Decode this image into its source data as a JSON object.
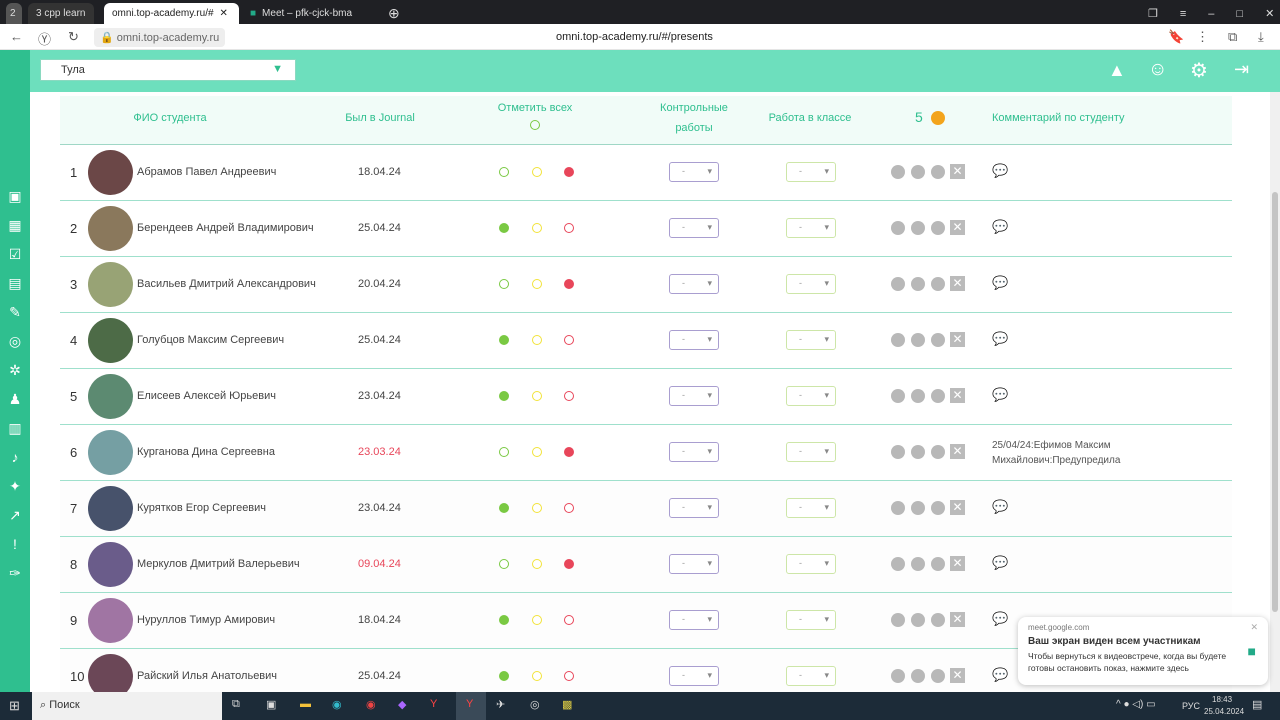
{
  "browser": {
    "tab_group_count": "2",
    "tabs": [
      {
        "label": "3  cpp learn"
      },
      {
        "label": "omni.top-academy.ru/#"
      },
      {
        "label": "Meet – pfk-cjck-bma"
      }
    ],
    "address_short": "omni.top-academy.ru",
    "address_full": "omni.top-academy.ru/#/presents"
  },
  "header": {
    "city": "Тула"
  },
  "table": {
    "headers": {
      "name": "ФИО студента",
      "journal": "Был в Journal",
      "mark_all": "Отметить всех",
      "tests": "Контрольные работы",
      "classwork": "Работа в классе",
      "coins": "5",
      "comment": "Комментарий по студенту"
    },
    "select_placeholder": "-",
    "rows": [
      {
        "n": "1",
        "name": "Абрамов Павел Андреевич",
        "date": "18.04.24",
        "date_late": false,
        "status": "absent",
        "comment": ""
      },
      {
        "n": "2",
        "name": "Берендеев Андрей Владимирович",
        "date": "25.04.24",
        "date_late": false,
        "status": "present",
        "comment": ""
      },
      {
        "n": "3",
        "name": "Васильев Дмитрий Александрович",
        "date": "20.04.24",
        "date_late": false,
        "status": "absent",
        "comment": ""
      },
      {
        "n": "4",
        "name": "Голубцов Максим Сергеевич",
        "date": "25.04.24",
        "date_late": false,
        "status": "present",
        "comment": ""
      },
      {
        "n": "5",
        "name": "Елисеев Алексей Юрьевич",
        "date": "23.04.24",
        "date_late": false,
        "status": "present",
        "comment": ""
      },
      {
        "n": "6",
        "name": "Курганова Дина Сергеевна",
        "date": "23.03.24",
        "date_late": true,
        "status": "absent",
        "comment": "25/04/24:Ефимов Максим Михайлович:Предупредила"
      },
      {
        "n": "7",
        "name": "Курятков Егор Сергеевич",
        "date": "23.04.24",
        "date_late": false,
        "status": "present",
        "comment": ""
      },
      {
        "n": "8",
        "name": "Меркулов Дмитрий Валерьевич",
        "date": "09.04.24",
        "date_late": true,
        "status": "absent",
        "comment": ""
      },
      {
        "n": "9",
        "name": "Нуруллов Тимур Амирович",
        "date": "18.04.24",
        "date_late": false,
        "status": "present",
        "comment": ""
      },
      {
        "n": "10",
        "name": "Райский Илья Анатольевич",
        "date": "25.04.24",
        "date_late": false,
        "status": "present",
        "comment": ""
      }
    ]
  },
  "toast": {
    "source": "meet.google.com",
    "title": "Ваш экран виден всем участникам",
    "body": "Чтобы вернуться к видеовстрече, когда вы будете готовы остановить показ, нажмите здесь"
  },
  "taskbar": {
    "search": "Поиск",
    "lang": "РУС",
    "time": "18:43",
    "date": "25.04.2024"
  },
  "colors": {
    "accent": "#2fbf8f",
    "header": "#6ddfbd",
    "green": "#7ac943",
    "yellow": "#f2e33a",
    "red": "#e8465a"
  }
}
